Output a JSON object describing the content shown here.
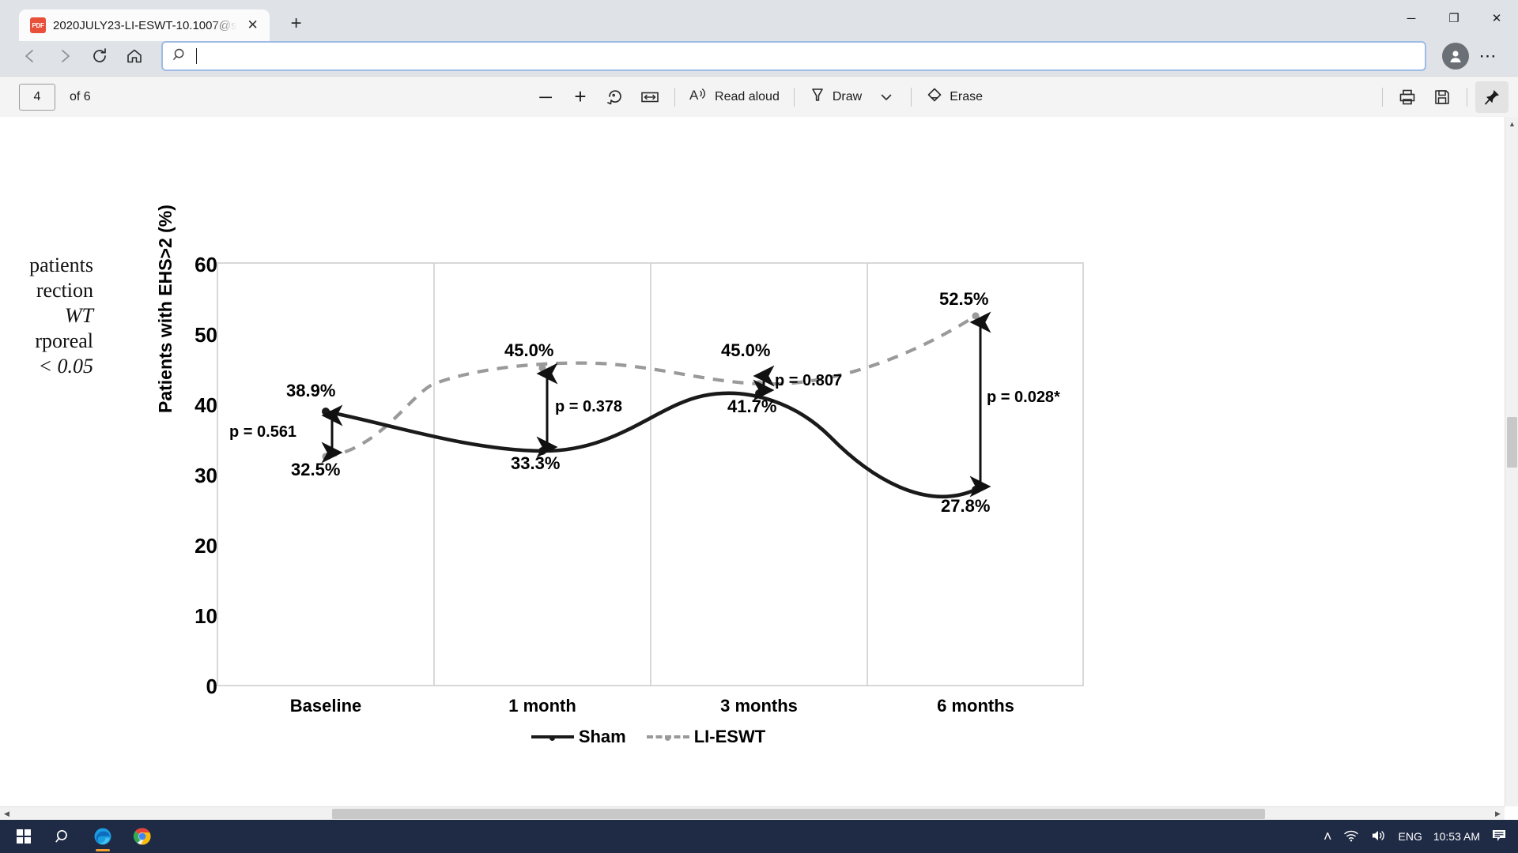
{
  "browser": {
    "tab": {
      "title": "2020JULY23-LI-ESWT-10.1007@s",
      "favicon": "pdf-file-icon",
      "close": "✕"
    },
    "new_tab_label": "+",
    "window_controls": {
      "minimize": "─",
      "maximize": "❐",
      "close": "✕"
    },
    "nav": {
      "back": "back-arrow-icon",
      "forward": "forward-arrow-icon",
      "reload": "reload-icon",
      "home": "home-icon"
    },
    "address_bar": {
      "value": "",
      "placeholder": "",
      "icon": "search-icon"
    },
    "profile": "profile-avatar",
    "settings_more": "⋯"
  },
  "pdf_toolbar": {
    "page_number": "4",
    "page_of": "of 6",
    "zoom_out": "─",
    "zoom_in": "+",
    "rotate": "rotate-icon",
    "fit_width": "fit-to-width-icon",
    "read_aloud": "Read aloud",
    "read_aloud_icon": "Aᴴ",
    "draw": "Draw",
    "draw_chevron": "⌄",
    "erase": "Erase",
    "print": "print-icon",
    "save": "save-icon",
    "pin": "pin-icon"
  },
  "document": {
    "caption_fragment_lines": [
      "patients",
      "rection",
      "WT",
      "rporeal",
      "< 0.05"
    ]
  },
  "chart_data": {
    "type": "line",
    "title": "",
    "xlabel": "",
    "ylabel": "Patients with EHS>2 (%)",
    "categories": [
      "Baseline",
      "1 month",
      "3 months",
      "6 months"
    ],
    "ylim": [
      0,
      60
    ],
    "yticks": [
      0,
      10,
      20,
      30,
      40,
      50,
      60
    ],
    "grid": "vertical-category-separators",
    "legend_position": "bottom-center",
    "series": [
      {
        "name": "Sham",
        "style": "solid",
        "color": "#1a1a1a",
        "values": [
          38.9,
          33.3,
          41.7,
          27.8
        ],
        "labels": [
          "38.9%",
          "33.3%",
          "41.7%",
          "27.8%"
        ]
      },
      {
        "name": "LI-ESWT",
        "style": "dashed",
        "color": "#9a9a9a",
        "values": [
          32.5,
          45.0,
          45.0,
          52.5
        ],
        "labels": [
          "32.5%",
          "45.0%",
          "45.0%",
          "52.5%"
        ]
      }
    ],
    "annotations": [
      {
        "category": "Baseline",
        "text": "p = 0.561",
        "significant": false
      },
      {
        "category": "1 month",
        "text": "p = 0.378",
        "significant": false
      },
      {
        "category": "3 months",
        "text": "p = 0.807",
        "significant": false
      },
      {
        "category": "6 months",
        "text": "p = 0.028*",
        "significant": true
      }
    ]
  },
  "taskbar": {
    "start": "windows-start-icon",
    "search": "search-icon",
    "edge": "edge-browser-icon",
    "chrome": "chrome-browser-icon",
    "tray_chevron": "˄",
    "network": "wifi-icon",
    "volume": "speaker-icon",
    "language": "ENG",
    "time": "10:53 AM",
    "notifications": "notification-icon"
  }
}
